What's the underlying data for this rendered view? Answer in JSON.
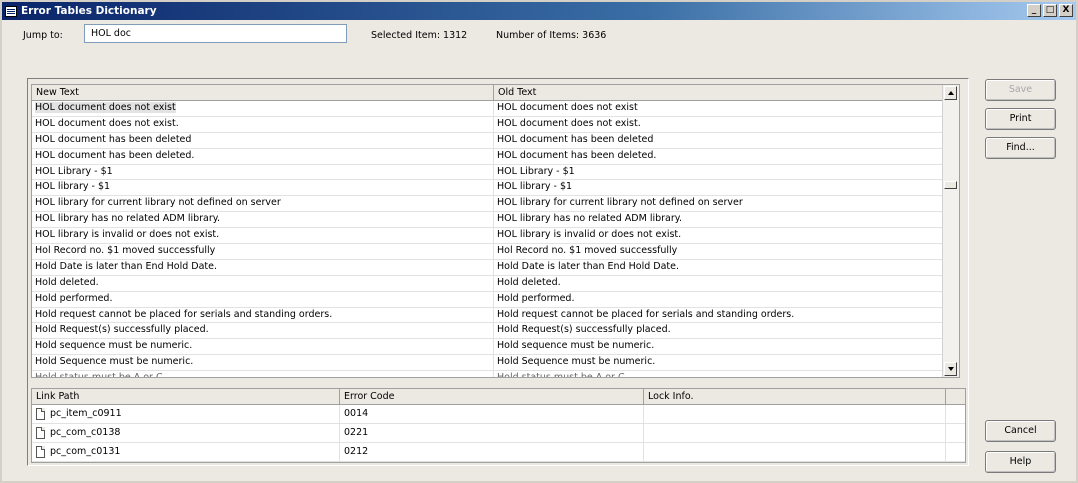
{
  "window": {
    "title": "Error Tables Dictionary"
  },
  "titlebar_buttons": [
    "_",
    "□",
    "X"
  ],
  "jump": {
    "label": "Jump to:",
    "value": "HOL doc"
  },
  "selected_item": "Selected Item: 1312",
  "number_of_items": "Number of Items: 3636",
  "upper_table": {
    "columns": [
      "New Text",
      "Old Text"
    ],
    "rows": [
      [
        "HOL document does not exist",
        "HOL document does not exist"
      ],
      [
        "HOL document does not exist.",
        "HOL document does not exist."
      ],
      [
        "HOL document has been deleted",
        "HOL document has been deleted"
      ],
      [
        "HOL document has been deleted.",
        "HOL document has been deleted."
      ],
      [
        "HOL Library - $1",
        "HOL Library - $1"
      ],
      [
        "HOL library - $1",
        "HOL library - $1"
      ],
      [
        "HOL library for current library not defined on server",
        "HOL library for current library not defined on server"
      ],
      [
        "HOL library has no related ADM library.",
        "HOL library has no related ADM library."
      ],
      [
        "HOL library is invalid or does not exist.",
        "HOL library is invalid or does not exist."
      ],
      [
        "Hol Record no. $1 moved successfully",
        "Hol Record no. $1 moved successfully"
      ],
      [
        "Hold Date is later than End Hold Date.",
        "Hold Date is later than End Hold Date."
      ],
      [
        "Hold deleted.",
        "Hold deleted."
      ],
      [
        "Hold performed.",
        "Hold performed."
      ],
      [
        "Hold request cannot be placed for serials and standing orders.",
        "Hold request cannot be placed for serials and standing orders."
      ],
      [
        "Hold Request(s) successfully placed.",
        "Hold Request(s) successfully placed."
      ],
      [
        "Hold sequence must be numeric.",
        "Hold sequence must be numeric."
      ],
      [
        "Hold Sequence must be numeric.",
        "Hold Sequence must be numeric."
      ],
      [
        "Hold status must be A or C",
        "Hold status must be A or C"
      ]
    ]
  },
  "lower_table": {
    "columns": [
      "Link Path",
      "Error Code",
      "Lock Info."
    ],
    "rows": [
      [
        "pc_item_c0911",
        "0014",
        ""
      ],
      [
        "pc_com_c0138",
        "0221",
        ""
      ],
      [
        "pc_com_c0131",
        "0212",
        ""
      ]
    ]
  },
  "buttons": {
    "save": "Save",
    "print": "Print",
    "find": "Find...",
    "cancel": "Cancel",
    "help": "Help"
  }
}
